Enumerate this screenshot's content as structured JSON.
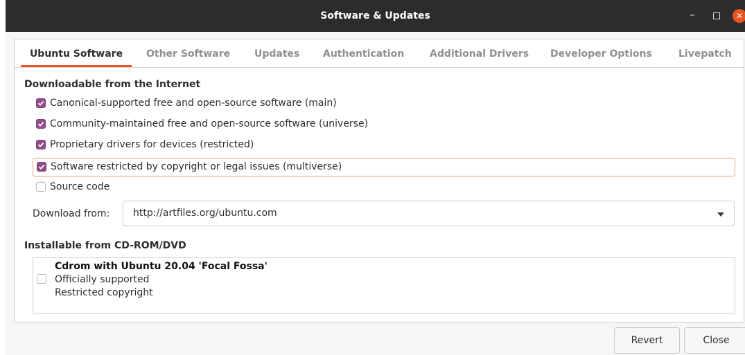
{
  "window": {
    "title": "Software & Updates"
  },
  "tabs": [
    {
      "label": "Ubuntu Software",
      "active": true
    },
    {
      "label": "Other Software"
    },
    {
      "label": "Updates"
    },
    {
      "label": "Authentication"
    },
    {
      "label": "Additional Drivers"
    },
    {
      "label": "Developer Options"
    },
    {
      "label": "Livepatch"
    }
  ],
  "internet": {
    "heading": "Downloadable from the Internet",
    "options": [
      {
        "label": "Canonical-supported free and open-source software (main)",
        "checked": true
      },
      {
        "label": "Community-maintained free and open-source software (universe)",
        "checked": true
      },
      {
        "label": "Proprietary drivers for devices (restricted)",
        "checked": true
      },
      {
        "label": "Software restricted by copyright or legal issues (multiverse)",
        "checked": true
      },
      {
        "label": "Source code",
        "checked": false
      }
    ],
    "download_from_label": "Download from:",
    "download_from_value": "http://artfiles.org/ubuntu.com"
  },
  "cdrom": {
    "heading": "Installable from CD-ROM/DVD",
    "item": {
      "title": "Cdrom with Ubuntu 20.04 'Focal Fossa'",
      "line2": "Officially supported",
      "line3": "Restricted copyright",
      "checked": false
    }
  },
  "buttons": {
    "revert": "Revert",
    "close": "Close"
  },
  "colors": {
    "accent": "#e95420",
    "checkbox": "#924d8b",
    "titlebar": "#2c2c2c"
  }
}
